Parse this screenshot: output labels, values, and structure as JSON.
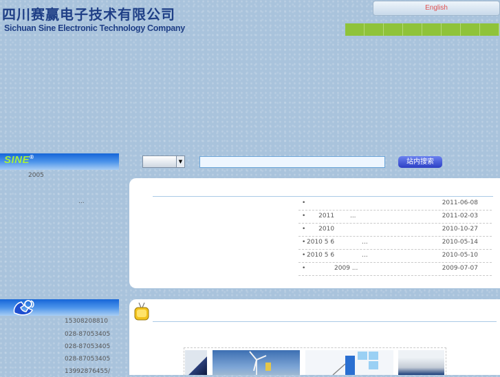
{
  "header": {
    "company_cn": "四川赛赢电子技术有限公司",
    "company_en": "Sichuan Sine Electronic Technology Company",
    "language_button": "English",
    "nav_items": [
      "",
      "",
      "",
      "",
      "",
      "",
      "",
      ""
    ]
  },
  "about": {
    "logo_text": "SINE",
    "logo_mark": "®",
    "year_text": "2005",
    "more_text": "..."
  },
  "contact": {
    "icon": "telephone-icon",
    "lines": [
      "15308208810",
      "028-87053405",
      "028-87053405",
      "028-87053405",
      "13992876455/"
    ]
  },
  "search": {
    "select_value": "",
    "input_value": "",
    "button_label": "站内搜索"
  },
  "news": {
    "items": [
      {
        "title": "",
        "date": "2011-06-08"
      },
      {
        "title": "      2011        ...",
        "date": "2011-02-03"
      },
      {
        "title": "      2010",
        "date": "2010-10-27"
      },
      {
        "title": "2010 5 6              ...",
        "date": "2010-05-14"
      },
      {
        "title": "2010 5 6              ...",
        "date": "2010-05-10"
      },
      {
        "title": "              2009 ...",
        "date": "2009-07-07"
      }
    ]
  },
  "products": {
    "icon": "tv-icon",
    "thumbnails": [
      "product-thumb-1",
      "product-thumb-2",
      "product-thumb-3",
      "product-thumb-4"
    ]
  },
  "colors": {
    "nav_green": "#8fc33a",
    "panel_blue": "#1565d8",
    "search_button": "#2c3fc4",
    "english_text": "#e05050"
  }
}
